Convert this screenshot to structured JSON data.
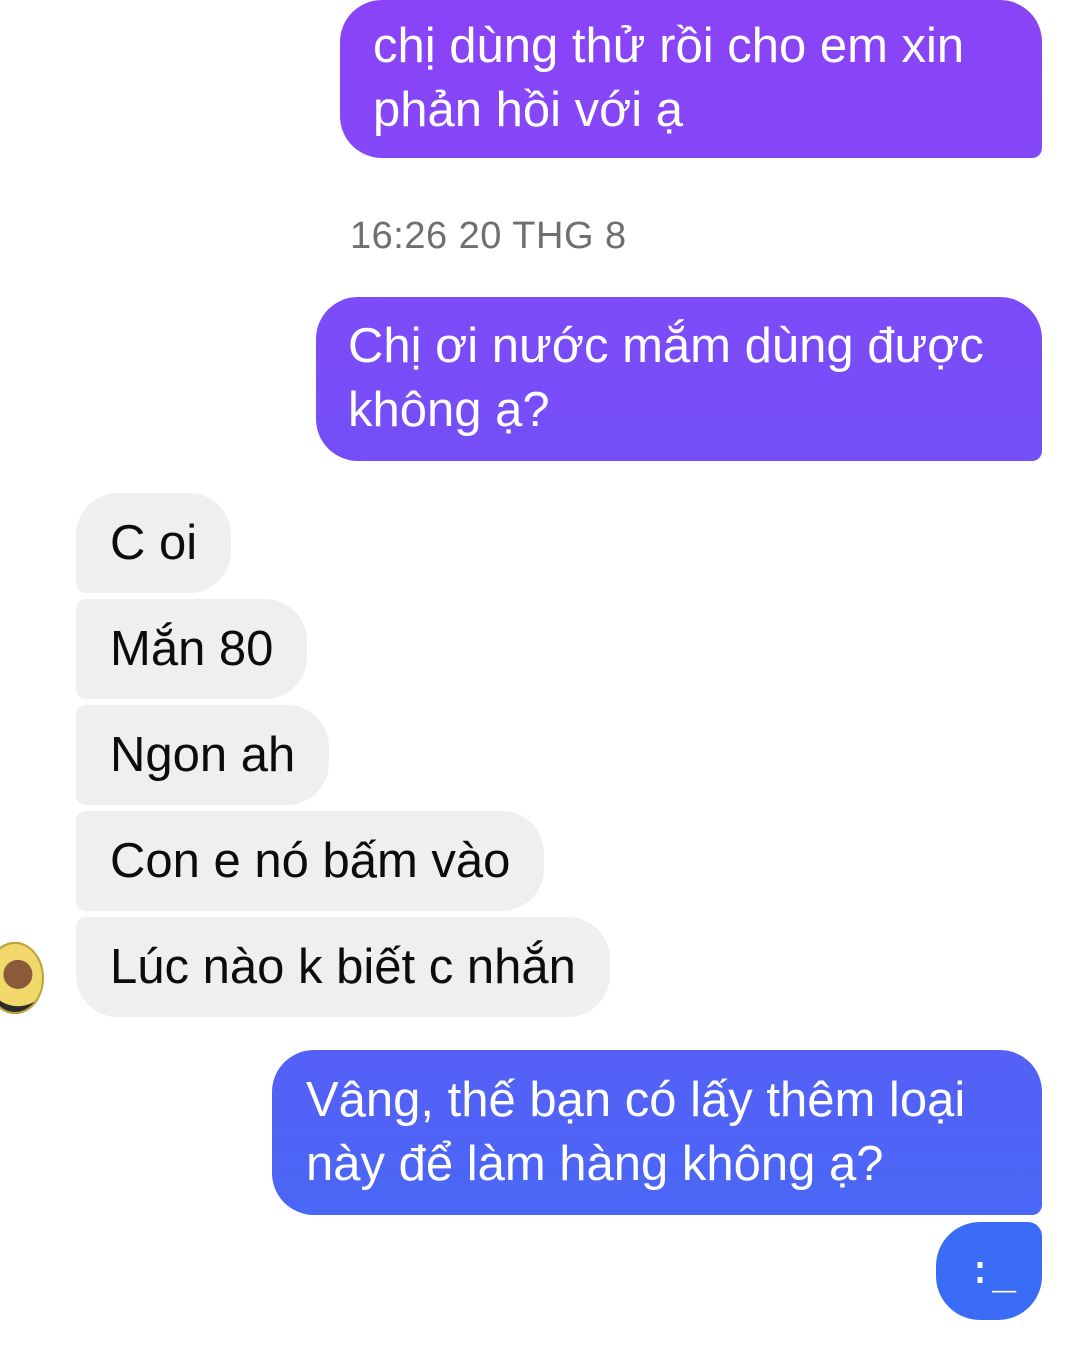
{
  "messages": {
    "outgoing_1": "chị dùng thử rồi cho em xin\nphản hồi với ạ",
    "timestamp": "16:26 20 THG 8",
    "outgoing_2": "Chị ơi nước mắm dùng được\nkhông ạ?",
    "incoming": [
      "C oi",
      "Mắn 80",
      "Ngon ah",
      "Con e nó bấm vào",
      "Lúc nào k biết c nhắn"
    ],
    "outgoing_3": "Vâng, thế bạn có lấy thêm loại\nnày để làm hàng không ạ?",
    "typing_glyph": ":_"
  },
  "colors": {
    "outgoing_top": "#8a43f7",
    "outgoing_mid": "#7b4cf8",
    "outgoing_bottom": "#4d63f6",
    "incoming_bg": "#efeff1",
    "timestamp_text": "#6f6f73"
  },
  "icons": {
    "avatar": "contact-avatar",
    "typing": "typing-indicator-icon"
  }
}
